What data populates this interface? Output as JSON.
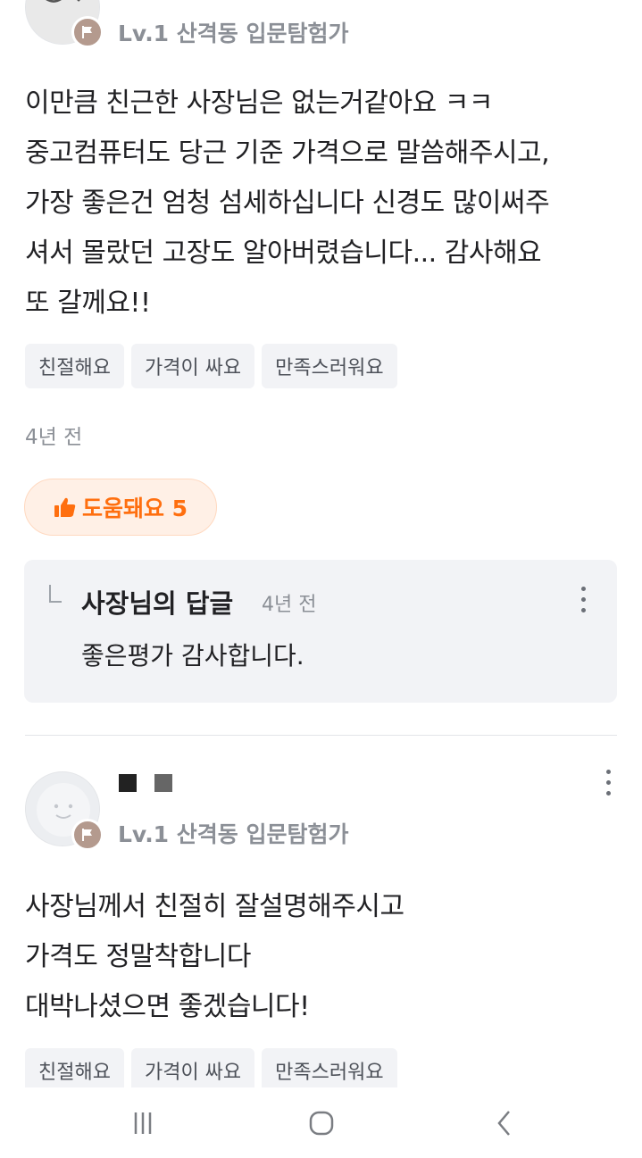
{
  "review1": {
    "level_text": "Lv.1 산격동 입문탐험가",
    "body": "이만큼 친근한 사장님은 없는거같아요 ㅋㅋ\n중고컴퓨터도 당근 기준 가격으로 말씀해주시고,\n가장 좋은건 엄청 섬세하십니다 신경도 많이써주\n셔서 몰랐던 고장도 알아버렸습니다... 감사해요\n또 갈께요!!",
    "tags": [
      "친절해요",
      "가격이 싸요",
      "만족스러워요"
    ],
    "time": "4년 전",
    "helpful_label": "도움돼요 5",
    "reply": {
      "title": "사장님의 답글",
      "time": "4년 전",
      "text": "좋은평가 감사합니다."
    }
  },
  "review2": {
    "level_text": "Lv.1 산격동 입문탐험가",
    "body": "사장님께서 친절히 잘설명해주시고\n가격도 정말착합니다\n대박나셨으면 좋겠습니다!",
    "tags": [
      "친절해요",
      "가격이 싸요",
      "만족스러워요"
    ]
  },
  "icons": {
    "badge": "flag-icon",
    "helpful": "thumbs-up-icon",
    "more": "more-vertical-icon",
    "nav_recent": "recent-apps-icon",
    "nav_home": "home-icon",
    "nav_back": "back-icon"
  },
  "colors": {
    "accent": "#ff6f0f",
    "accent_bg": "#fff0e6",
    "badge": "#b49a8e",
    "muted_text": "#8b8f96",
    "tag_bg": "#f2f3f6"
  }
}
